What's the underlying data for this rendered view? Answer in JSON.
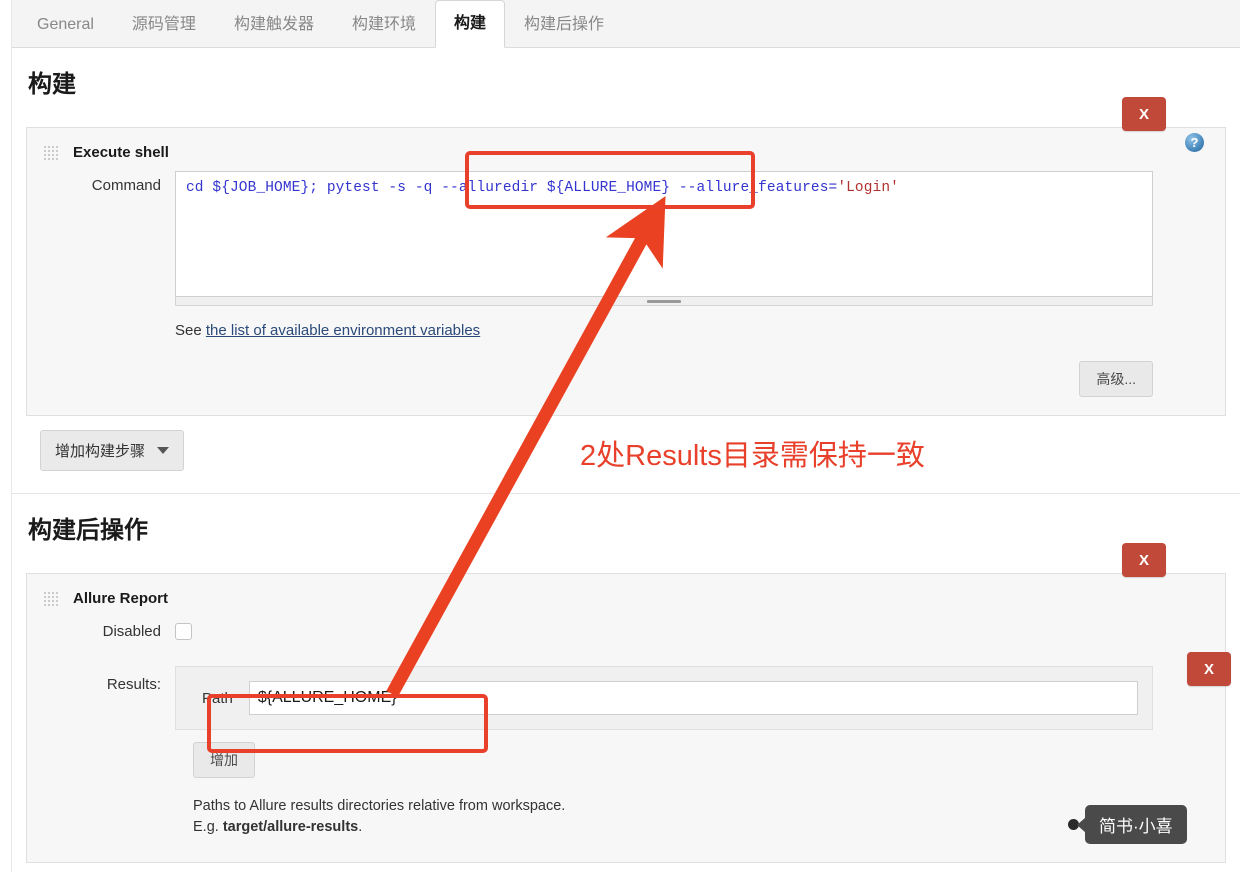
{
  "tabs": [
    {
      "label": "General",
      "active": false
    },
    {
      "label": "源码管理",
      "active": false
    },
    {
      "label": "构建触发器",
      "active": false
    },
    {
      "label": "构建环境",
      "active": false
    },
    {
      "label": "构建",
      "active": true
    },
    {
      "label": "构建后操作",
      "active": false
    }
  ],
  "build_section": {
    "title": "构建",
    "block_title": "Execute shell",
    "command_label": "Command",
    "command_value": "cd ${JOB_HOME}; pytest -s -q --alluredir ${ALLURE_HOME} --allure_features=",
    "command_literal": "'Login'",
    "help_prefix": "See ",
    "help_link": "the list of available environment variables",
    "advanced_button": "高级...",
    "close_button": "X",
    "help_icon": "?",
    "add_step_button": "增加构建步骤"
  },
  "post_build_section": {
    "title": "构建后操作",
    "block_title": "Allure Report",
    "disabled_label": "Disabled",
    "results_label": "Results:",
    "path_label": "Path",
    "path_value": "${ALLURE_HOME}",
    "add_button": "增加",
    "close_button": "X",
    "results_close_button": "X",
    "note_line1": "Paths to Allure results directories relative from workspace.",
    "note_prefix": "E.g. ",
    "note_bold": "target/allure-results",
    "note_suffix": "."
  },
  "annotation": {
    "text": "2处Results目录需保持一致",
    "color": "#e8402a"
  },
  "watermark": {
    "text": "简书·小喜"
  }
}
